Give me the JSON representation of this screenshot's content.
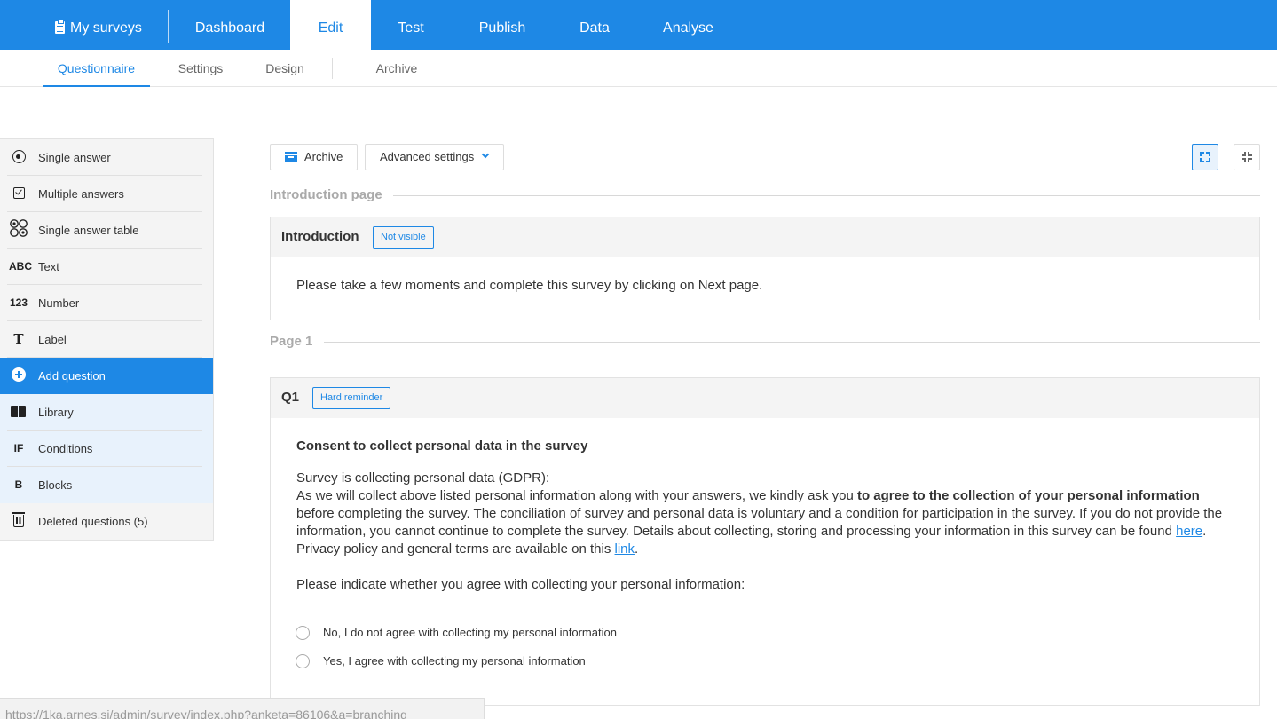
{
  "topnav": {
    "my_surveys": "My surveys",
    "items": [
      "Dashboard",
      "Edit",
      "Test",
      "Publish",
      "Data",
      "Analyse"
    ],
    "active": "Edit"
  },
  "subnav": {
    "items": [
      "Questionnaire",
      "Settings",
      "Design",
      "Archive"
    ],
    "active": "Questionnaire"
  },
  "sidebar": {
    "items": [
      {
        "icon": "radio-icon",
        "label": "Single answer"
      },
      {
        "icon": "checkbox-icon",
        "label": "Multiple answers"
      },
      {
        "icon": "grid-icon",
        "label": "Single answer table"
      },
      {
        "icon": "ABC",
        "label": "Text"
      },
      {
        "icon": "123",
        "label": "Number"
      },
      {
        "icon": "T",
        "label": "Label"
      },
      {
        "icon": "plus-circle-icon",
        "label": "Add question"
      },
      {
        "icon": "book-icon",
        "label": "Library"
      },
      {
        "icon": "IF",
        "label": "Conditions"
      },
      {
        "icon": "B",
        "label": "Blocks"
      },
      {
        "icon": "trash-icon",
        "label": "Deleted questions (5)"
      }
    ]
  },
  "toolbar": {
    "archive_label": "Archive",
    "advanced_label": "Advanced settings"
  },
  "intro_section": {
    "heading": "Introduction page",
    "card_title": "Introduction",
    "badge": "Not visible",
    "text": "Please take a few moments and complete this survey by clicking on Next page."
  },
  "page1_section": {
    "heading": "Page 1",
    "question_id": "Q1",
    "badge": "Hard reminder",
    "question_title": "Consent to collect personal data in the survey",
    "line1": "Survey is collecting personal data (GDPR):",
    "line2_a": "As we will collect above listed personal information along with your answers, we kindly ask you ",
    "line2_bold": "to agree to the collection of your personal information",
    "line2_b": " before completing the survey. The conciliation of survey and personal data is voluntary and a condition for participation in the survey. If you do not provide the information, you cannot continue to complete the survey. Details about collecting, storing and processing your information in this survey can be found ",
    "link_here": "here",
    "line2_c": ". Privacy policy and general terms are available on this ",
    "link_link": "link",
    "line2_d": ".",
    "prompt": "Please indicate whether you agree with collecting your personal information:",
    "options": [
      "No, I do not agree with collecting my personal information",
      "Yes, I agree with collecting my personal information"
    ]
  },
  "status_url": "https://1ka.arnes.si/admin/survey/index.php?anketa=86106&a=branching"
}
